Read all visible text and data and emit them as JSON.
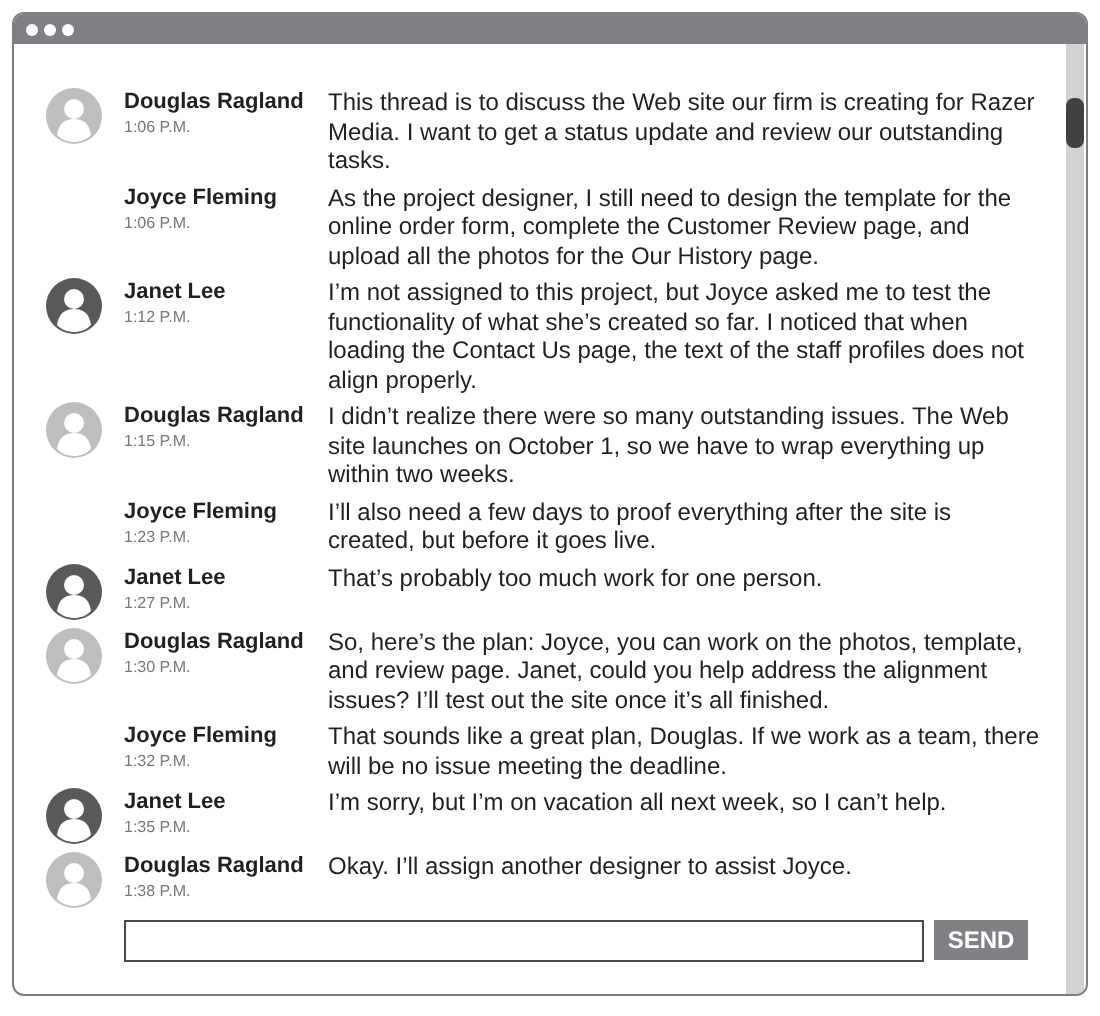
{
  "messages": [
    {
      "sender": "Douglas Ragland",
      "time": "1:06 P.M.",
      "color": "#bdbec0",
      "text": "This thread is to discuss the Web site our firm is creating for Razer Media. I want to get a status update and review our outstanding tasks."
    },
    {
      "sender": "Joyce Fleming",
      "time": "1:06 P.M.",
      "text": "As the project designer, I still need to design the template for the online order form, complete the Customer Review page, and upload all the photos for the Our History page."
    },
    {
      "sender": "Janet Lee",
      "time": "1:12 P.M.",
      "color": "#58595b",
      "text": "I’m not assigned to this project, but Joyce asked me to test the functionality of what she’s created so far. I noticed that when loading the Contact Us page, the text of the staff profiles does not align properly."
    },
    {
      "sender": "Douglas Ragland",
      "time": "1:15 P.M.",
      "color": "#bdbec0",
      "text": "I didn’t realize there were so many outstanding issues. The Web site launches on October 1, so we have to wrap everything up within two weeks."
    },
    {
      "sender": "Joyce Fleming",
      "time": "1:23 P.M.",
      "text": "I’ll also need a few days to proof everything after the site is created, but before it goes live."
    },
    {
      "sender": "Janet Lee",
      "time": "1:27 P.M.",
      "color": "#58595b",
      "text": "That’s probably too much work for one person."
    },
    {
      "sender": "Douglas Ragland",
      "time": "1:30 P.M.",
      "color": "#bdbec0",
      "text": "So, here’s the plan: Joyce, you can work on the photos, template, and review page. Janet, could you help address the alignment issues? I’ll test out the site once it’s all finished."
    },
    {
      "sender": "Joyce Fleming",
      "time": "1:32 P.M.",
      "text": "That sounds like a great plan, Douglas. If we work as a team, there will be no issue meeting the deadline."
    },
    {
      "sender": "Janet Lee",
      "time": "1:35 P.M.",
      "color": "#58595b",
      "text": "I’m sorry, but I’m on vacation all next week, so I can’t help."
    },
    {
      "sender": "Douglas Ragland",
      "time": "1:38 P.M.",
      "color": "#bdbec0",
      "text": "Okay. I’ll assign another designer to assist Joyce."
    }
  ],
  "composer": {
    "button": "SEND"
  }
}
